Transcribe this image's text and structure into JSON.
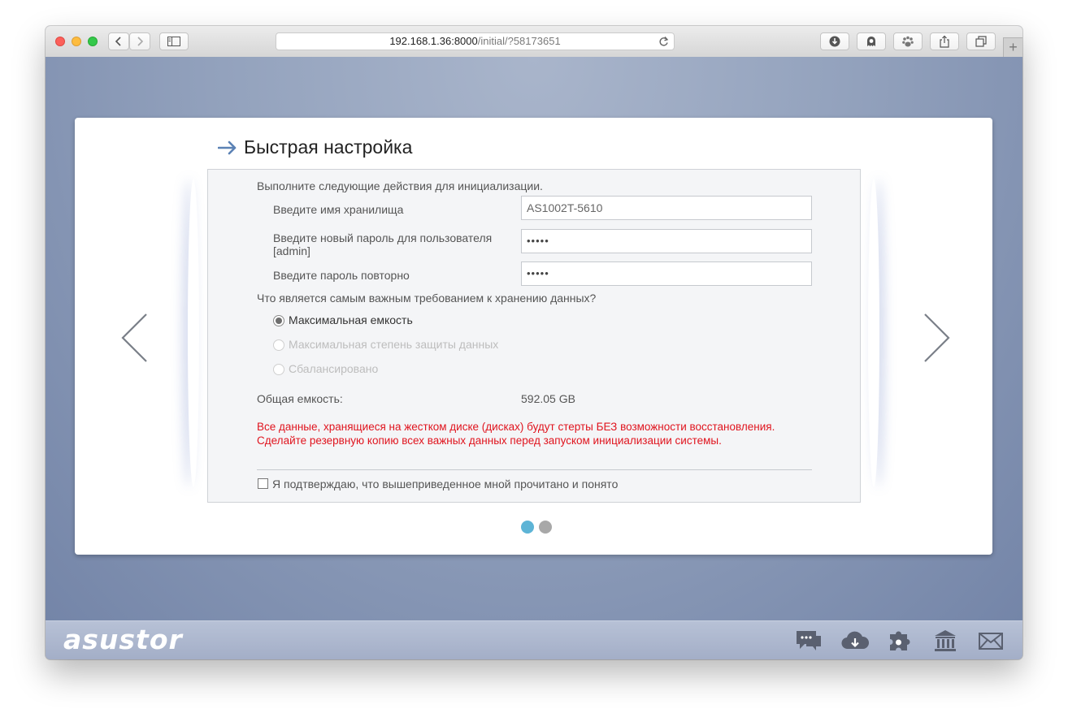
{
  "browser": {
    "url_host": "192.168.1.36:8000",
    "url_path": "/initial/?58173651"
  },
  "page": {
    "title": "Быстрая настройка",
    "intro": "Выполните следующие действия для инициализации.",
    "fields": {
      "storage_name_label": "Введите имя хранилища",
      "storage_name_value": "AS1002T-5610",
      "password_label": "Введите новый пароль для пользователя [admin]",
      "password_value": "•••••",
      "confirm_label": "Введите пароль повторно",
      "confirm_value": "•••••"
    },
    "question": "Что является самым важным требованием к хранению данных?",
    "options": [
      {
        "label": "Максимальная емкость",
        "checked": true,
        "disabled": false
      },
      {
        "label": "Максимальная степень защиты данных",
        "checked": false,
        "disabled": true
      },
      {
        "label": "Сбалансировано",
        "checked": false,
        "disabled": true
      }
    ],
    "capacity_label": "Общая емкость:",
    "capacity_value": "592.05 GB",
    "warning_line1": "Все данные, хранящиеся на жестком диске (дисках) будут стерты БЕЗ возможности восстановления.",
    "warning_line2": "Сделайте резервную копию всех важных данных перед запуском инициализации системы.",
    "confirm_checkbox_label": "Я подтверждаю, что вышеприведенное мной прочитано и понято",
    "pagination": {
      "current": 1,
      "total": 2
    }
  },
  "footer": {
    "logo": "asustor",
    "icons": [
      "chat-icon",
      "cloud-download-icon",
      "puzzle-icon",
      "bank-icon",
      "mail-icon"
    ]
  },
  "colors": {
    "warning": "#e0141e",
    "accent": "#5db4d6",
    "heading_arrow": "#5b82b5"
  }
}
